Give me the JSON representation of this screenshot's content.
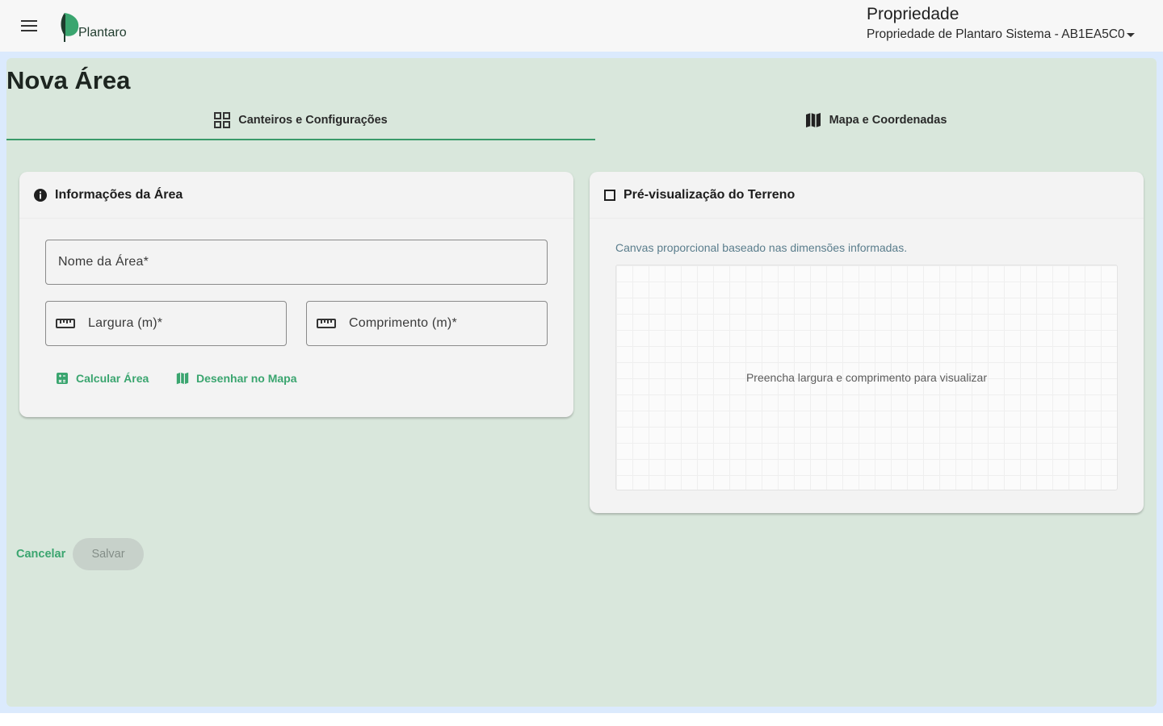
{
  "header": {
    "logo_text": "Plantaro",
    "property_title": "Propriedade",
    "property_selected": "Propriedade de Plantaro Sistema - AB1EA5C0"
  },
  "page": {
    "title": "Nova Área"
  },
  "tabs": [
    {
      "label": "Canteiros e Configurações",
      "icon": "grid-icon",
      "active": true
    },
    {
      "label": "Mapa e Coordenadas",
      "icon": "map-icon",
      "active": false
    }
  ],
  "area_info": {
    "title": "Informações da Área",
    "name_label": "Nome da Área*",
    "width_label": "Largura (m)*",
    "length_label": "Comprimento (m)*",
    "calc_button": "Calcular Área",
    "draw_button": "Desenhar no Mapa"
  },
  "preview": {
    "title": "Pré-visualização do Terreno",
    "hint": "Canvas proporcional baseado nas dimensões informadas.",
    "empty_message": "Preencha largura e comprimento para visualizar"
  },
  "actions": {
    "cancel_label": "Cancelar",
    "save_label": "Salvar",
    "save_disabled": true
  },
  "colors": {
    "accent": "#3aa56f",
    "panel_bg": "#d9e7dc",
    "frame_bg": "#dbeafd"
  }
}
